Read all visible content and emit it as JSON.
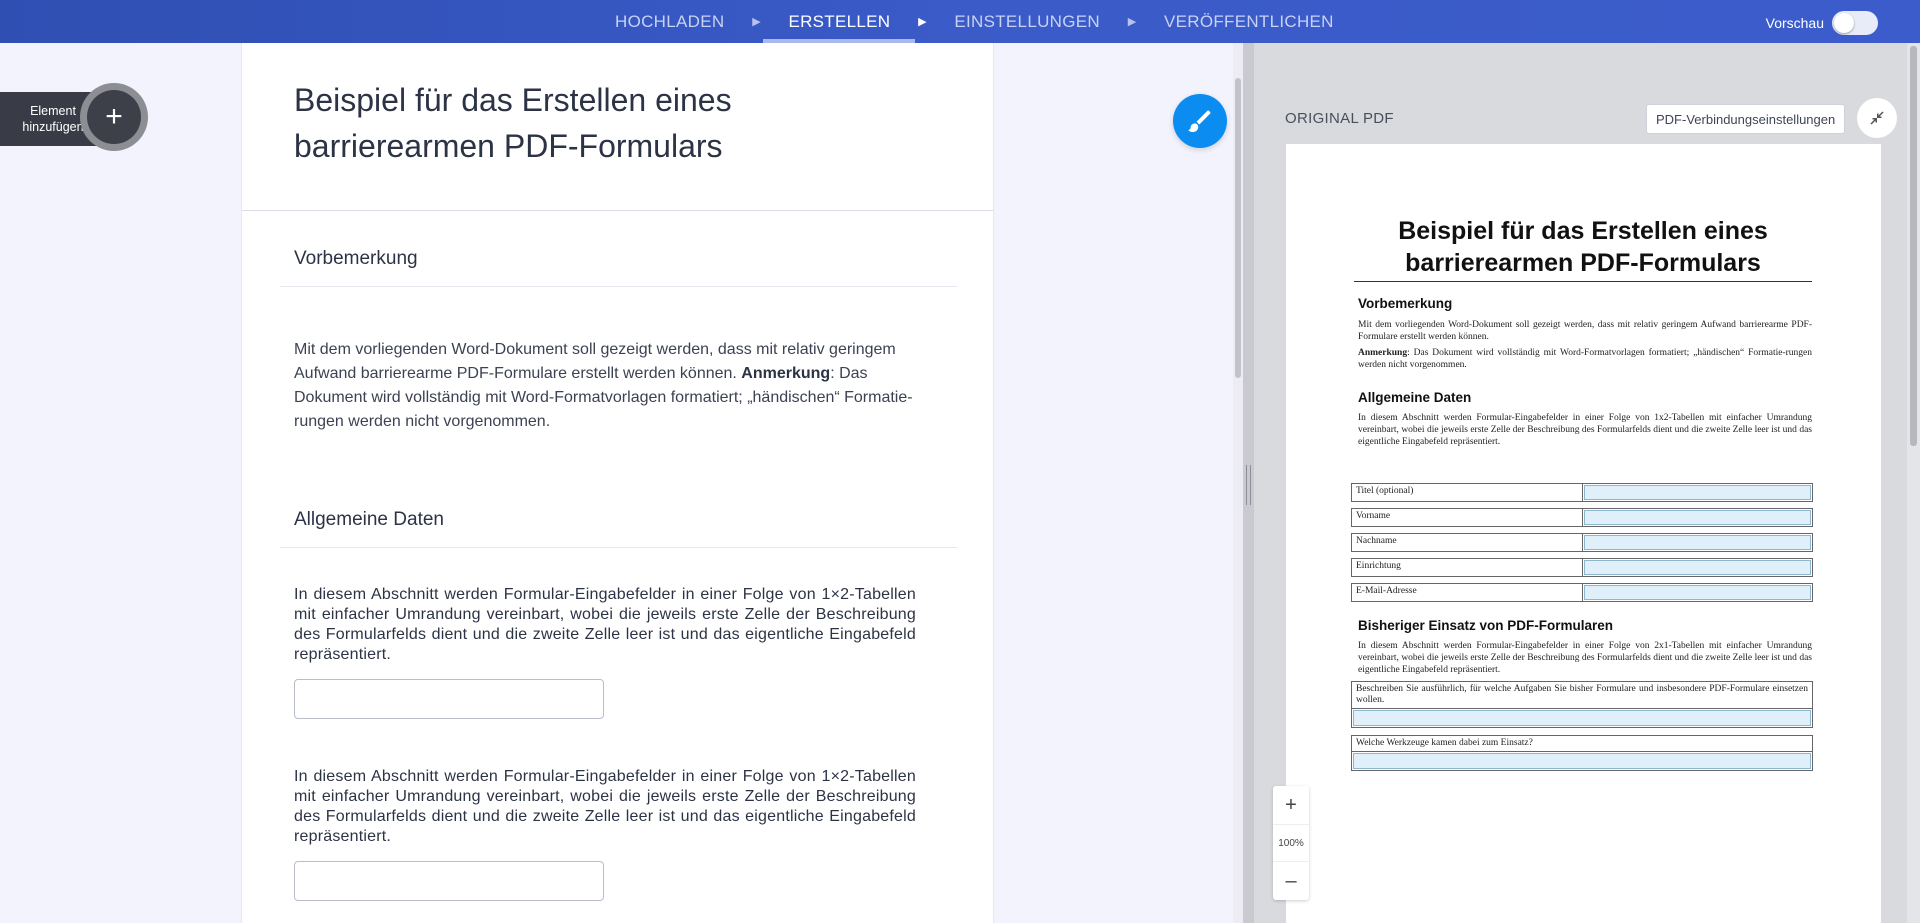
{
  "nav": {
    "steps": [
      {
        "label": "HOCHLADEN",
        "active": false
      },
      {
        "label": "ERSTELLEN",
        "active": true
      },
      {
        "label": "EINSTELLUNGEN",
        "active": false
      },
      {
        "label": "VERÖFFENTLICHEN",
        "active": false
      }
    ],
    "preview_label": "Vorschau",
    "preview_on": false
  },
  "sidebar": {
    "add_element_label_1": "Element",
    "add_element_label_2": "hinzufügen",
    "add_icon": "plus-icon"
  },
  "form": {
    "title_line1": "Beispiel für das Erstellen eines",
    "title_line2": "barrierearmen PDF-Formulars",
    "section1_heading": "Vorbemerkung",
    "section1_text_a": "Mit dem vorliegenden Word-Dokument soll gezeigt werden, dass mit relativ geringem Aufwand barrierearme PDF-Formulare erstellt werden können. ",
    "section1_text_bold": "Anmerkung",
    "section1_text_b": ": Das Dokument wird vollständig mit Word-Formatvorlagen formatiert; „händischen“ Formatie- rungen werden nicht vorgenommen.",
    "section2_heading": "Allgemeine Daten",
    "field_desc_1": "In diesem Abschnitt werden Formular-Eingabefelder in einer Folge von 1×2-Tabellen mit einfacher Umrandung vereinbart, wobei die jeweils erste Zelle der Beschreibung des Formularfelds dient und die zweite Zelle leer ist und das eigentliche Eingabefeld repräsentiert.",
    "field_value_1": "",
    "field_desc_2": "In diesem Abschnitt werden Formular-Eingabefelder in einer Folge von 1×2-Tabellen mit einfacher Umrandung vereinbart, wobei die jeweils erste Zelle der Beschreibung des Formularfelds dient und die zweite Zelle leer ist und das eigentliche Eingabefeld repräsentiert.",
    "field_value_2": ""
  },
  "pdf_panel": {
    "title": "ORIGINAL PDF",
    "connection_button": "PDF-Verbindungseinstellungen",
    "zoom_in": "+",
    "zoom_level": "100%",
    "zoom_out": "–",
    "page": {
      "title_line1": "Beispiel für das Erstellen eines",
      "title_line2": "barrierearmen PDF-Formulars",
      "h1": "Vorbemerkung",
      "p1": "Mit dem vorliegenden Word-Dokument soll gezeigt werden, dass mit relativ geringem Aufwand barrierearme PDF-Formulare erstellt werden können.",
      "p2_bold": "Anmerkung",
      "p2": ": Das Dokument wird vollständig mit Word-Formatvorlagen formatiert; „händischen“ Formatie-rungen werden nicht vorgenommen.",
      "h2": "Allgemeine Daten",
      "p3": "In diesem Abschnitt werden Formular-Eingabefelder in einer Folge von 1x2-Tabellen mit einfacher Umrandung vereinbart, wobei die jeweils erste Zelle der Beschreibung des Formularfelds dient und die zweite Zelle leer ist und das eigentliche Eingabefeld repräsentiert.",
      "rows": [
        "Titel (optional)",
        "Vorname",
        "Nachname",
        "Einrichtung",
        "E-Mail-Adresse"
      ],
      "h3": "Bisheriger Einsatz von PDF-Formularen",
      "p4": "In diesem Abschnitt werden Formular-Eingabefelder in einer Folge von 2x1-Tabellen mit einfacher Umrandung vereinbart, wobei die jeweils erste Zelle der Beschreibung des Formularfelds dient und die zweite Zelle leer ist und das eigentliche Eingabefeld repräsentiert.",
      "box1": "Beschreiben Sie ausführlich, für welche Aufgaben Sie bisher Formulare und insbesondere PDF-Formulare einsetzen wollen.",
      "box2": "Welche Werkzeuge kamen dabei zum Einsatz?"
    }
  },
  "colors": {
    "topbar": "#3a5bc8",
    "accent_blue": "#0a8cf0",
    "input_fill": "#dff0fb"
  }
}
